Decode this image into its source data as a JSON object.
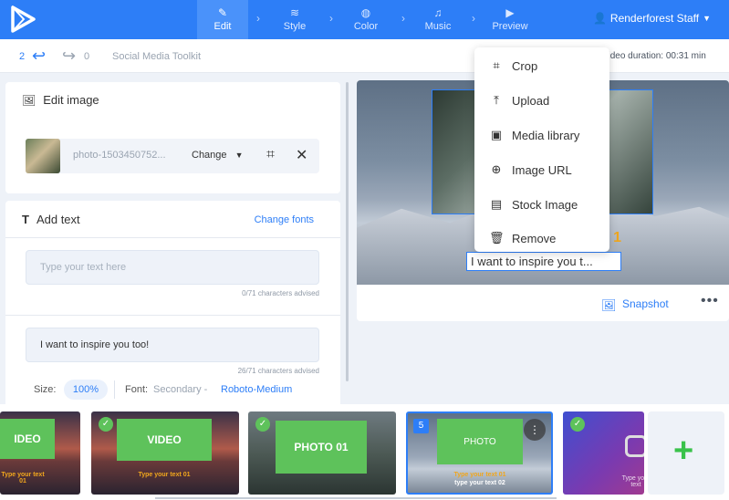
{
  "topbar": {
    "steps": [
      {
        "label": "Edit",
        "icon": "pencil-icon"
      },
      {
        "label": "Style",
        "icon": "layers-icon"
      },
      {
        "label": "Color",
        "icon": "palette-icon"
      },
      {
        "label": "Music",
        "icon": "music-icon"
      },
      {
        "label": "Preview",
        "icon": "play-icon"
      }
    ],
    "active_step": "Edit",
    "user": "Renderforest Staff"
  },
  "subbar": {
    "undo_count": "2",
    "redo_count": "0",
    "project": "Social Media Toolkit",
    "duration": "Video duration: 00:31 min"
  },
  "edit_image": {
    "title": "Edit image",
    "filename": "photo-1503450752...",
    "change_label": "Change"
  },
  "add_text": {
    "title": "Add text",
    "change_fonts": "Change fonts",
    "field1_placeholder": "Type your text here",
    "field1_count": "0/71 characters advised",
    "field2_value": "I want to inspire you too!",
    "field2_count": "26/71 characters advised",
    "size_label": "Size:",
    "size_value": "100%",
    "font_label": "Font:",
    "font_value": "Secondary -",
    "font_name": "Roboto-Medium"
  },
  "preview": {
    "overlay_text": "I want to inspire you t...",
    "snapshot": "Snapshot"
  },
  "menu": [
    {
      "label": "Crop",
      "icon": "crop-icon"
    },
    {
      "label": "Upload",
      "icon": "upload-icon"
    },
    {
      "label": "Media library",
      "icon": "media-library-icon"
    },
    {
      "label": "Image URL",
      "icon": "globe-icon"
    },
    {
      "label": "Stock Image",
      "icon": "stock-image-icon"
    },
    {
      "label": "Remove",
      "icon": "trash-icon"
    }
  ],
  "filmstrip": {
    "slides": [
      {
        "label": "IDEO",
        "sub": "Type your text 01"
      },
      {
        "label": "VIDEO",
        "sub": "Type your text 01"
      },
      {
        "label": "PHOTO 01"
      },
      {
        "label": "PHOTO",
        "sub1": "Type your text 01",
        "sub2": "type your text 02",
        "number": "5"
      },
      {
        "sub": "Type your text"
      }
    ],
    "add_label": "+"
  },
  "colors": {
    "accent": "#2d7ef7",
    "green": "#5ec25b",
    "yellow": "#f0a61d"
  }
}
